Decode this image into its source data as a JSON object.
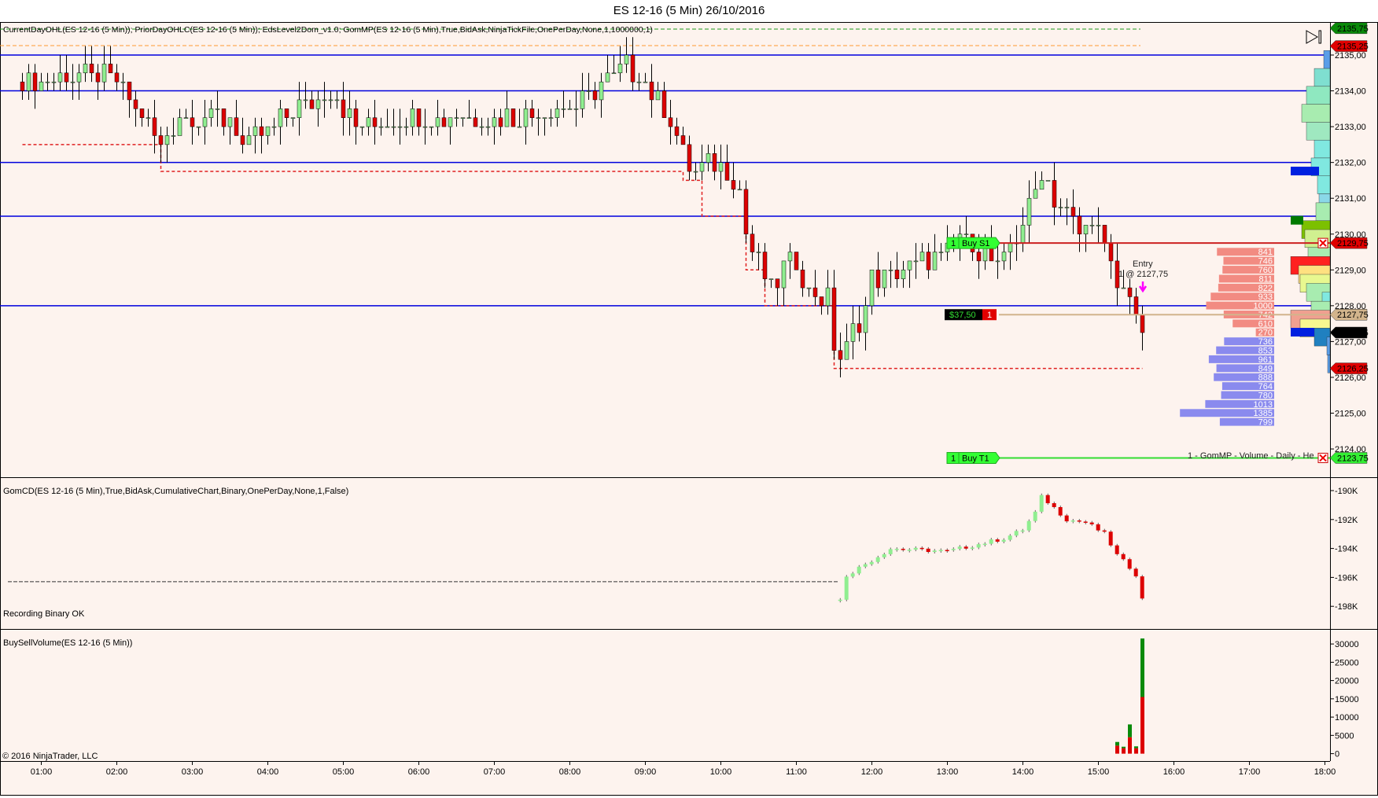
{
  "window": {
    "title": "ES 12-16 (5 Min)  26/10/2016"
  },
  "panels": {
    "price": {
      "indicator_label": "CurrentDayOHL(ES 12-16 (5 Min)); PriorDayOHLC(ES 12-16 (5 Min)); EdsLevel2Dom_v1.0; GomMP(ES 12-16 (5 Min),True,BidAsk,NinjaTickFile,OnePerDay,None,1,1000000,1)",
      "axis_ticks": [
        "2135,00",
        "2134,00",
        "2133,00",
        "2132,00",
        "2131,00",
        "2130,00",
        "2129,00",
        "2128,00",
        "2127,00",
        "2126,00",
        "2125,00",
        "2124,00"
      ],
      "axis_tick_values": [
        2135,
        2134,
        2133,
        2132,
        2131,
        2130,
        2129,
        2128,
        2127,
        2126,
        2125,
        2124
      ],
      "price_markers": [
        {
          "text": "2135,75",
          "value": 2135.75,
          "color": "#0a8a0a"
        },
        {
          "text": "2135,25",
          "value": 2135.25,
          "color": "#e00000"
        },
        {
          "text": "2129,75",
          "value": 2129.75,
          "color": "#e00000"
        },
        {
          "text": "2127,75",
          "value": 2127.75,
          "color": "#d2b48c"
        },
        {
          "text": "2127,25",
          "value": 2127.25,
          "color": "#000000"
        },
        {
          "text": "2126,25",
          "value": 2126.25,
          "color": "#e00000"
        },
        {
          "text": "2123,75",
          "value": 2123.75,
          "color": "#33ee33"
        }
      ],
      "blue_levels": [
        2135,
        2134,
        2132,
        2130.5,
        2128
      ],
      "price_path": [
        [
          "00:45",
          2134.25
        ],
        [
          "01:30",
          2134.5
        ],
        [
          "02:00",
          2134.25
        ],
        [
          "02:20",
          2133.25
        ],
        [
          "02:35",
          2132.5
        ],
        [
          "02:50",
          2133.25
        ],
        [
          "03:30",
          2133.25
        ],
        [
          "03:40",
          2132.5
        ],
        [
          "04:00",
          2132.75
        ],
        [
          "04:20",
          2133.5
        ],
        [
          "04:50",
          2134.0
        ],
        [
          "05:10",
          2133.0
        ],
        [
          "06:00",
          2133.25
        ],
        [
          "07:00",
          2133.25
        ],
        [
          "08:00",
          2133.5
        ],
        [
          "08:30",
          2134.25
        ],
        [
          "08:45",
          2134.75
        ],
        [
          "09:00",
          2134.25
        ],
        [
          "09:15",
          2133.5
        ],
        [
          "09:25",
          2132.75
        ],
        [
          "09:35",
          2131.75
        ],
        [
          "10:00",
          2132.0
        ],
        [
          "10:15",
          2131.25
        ],
        [
          "10:20",
          2130.0
        ],
        [
          "10:30",
          2129.25
        ],
        [
          "10:40",
          2128.5
        ],
        [
          "10:50",
          2129.0
        ],
        [
          "11:00",
          2129.25
        ],
        [
          "11:10",
          2128.25
        ],
        [
          "11:25",
          2128.25
        ],
        [
          "11:30",
          2127.0
        ],
        [
          "11:35",
          2126.5
        ],
        [
          "11:45",
          2127.25
        ],
        [
          "11:55",
          2128.0
        ],
        [
          "12:00",
          2128.75
        ],
        [
          "12:30",
          2129.0
        ],
        [
          "13:00",
          2129.5
        ],
        [
          "13:10",
          2130.0
        ],
        [
          "13:30",
          2129.5
        ],
        [
          "13:40",
          2129.0
        ],
        [
          "14:00",
          2130.25
        ],
        [
          "14:10",
          2131.25
        ],
        [
          "14:15",
          2131.75
        ],
        [
          "14:25",
          2131.0
        ],
        [
          "14:45",
          2130.0
        ],
        [
          "14:55",
          2130.5
        ],
        [
          "15:05",
          2129.5
        ],
        [
          "15:15",
          2128.5
        ],
        [
          "15:25",
          2128.5
        ],
        [
          "15:30",
          2127.75
        ],
        [
          "15:35",
          2127.0
        ]
      ],
      "prior_day_steps": [
        [
          "00:45",
          2132.5
        ],
        [
          "02:35",
          2131.75
        ],
        [
          "09:30",
          2131.5
        ],
        [
          "09:45",
          2130.5
        ],
        [
          "10:20",
          2129.0
        ],
        [
          "10:35",
          2128.0
        ],
        [
          "11:30",
          2126.25
        ],
        [
          "15:35",
          2126.25
        ]
      ],
      "dom_sell": {
        "prices": [
          2129.5,
          2129.25,
          2129.0,
          2128.75,
          2128.5,
          2128.25,
          2128.0,
          2127.75,
          2127.5,
          2127.25
        ],
        "sizes": [
          "841",
          "746",
          "760",
          "811",
          "822",
          "933",
          "1000",
          "742",
          "610",
          "270"
        ]
      },
      "dom_buy": {
        "prices": [
          2127.0,
          2126.75,
          2126.5,
          2126.25,
          2126.0,
          2125.75,
          2125.5,
          2125.25,
          2125.0,
          2124.75
        ],
        "sizes": [
          "736",
          "853",
          "961",
          "849",
          "888",
          "764",
          "780",
          "1013",
          "1385",
          "799"
        ]
      },
      "orders": {
        "stop": {
          "qty": "1",
          "label": "Buy S1",
          "price": 2129.75
        },
        "target": {
          "qty": "1",
          "label": "Buy T1",
          "price": 2123.75
        },
        "position": {
          "pnl": "$37,50",
          "qty": "1",
          "price": 2127.75
        },
        "entry": {
          "line1": "Entry",
          "line2": "1 @ 2127,75"
        }
      },
      "profile_label": "1 - GomMP - Volume - Daily - He",
      "current_day_high": 2135.75,
      "current_day_open": 2135.25
    },
    "cd": {
      "indicator_label": "GomCD(ES 12-16 (5 Min),True,BidAsk,CumulativeChart,Binary,OnePerDay,None,1,False)",
      "status": "Recording Binary OK",
      "axis_ticks": [
        "-190K",
        "-192K",
        "-194K",
        "-196K",
        "-198K"
      ],
      "axis_tick_values": [
        -190,
        -192,
        -194,
        -196,
        -198
      ],
      "flat_value": -196.3,
      "path": [
        [
          "11:35",
          -196.1
        ],
        [
          "12:00",
          -194.8
        ],
        [
          "12:15",
          -194.0
        ],
        [
          "13:00",
          -194.2
        ],
        [
          "13:15",
          -193.9
        ],
        [
          "13:45",
          -193.3
        ],
        [
          "14:00",
          -192.7
        ],
        [
          "14:10",
          -191.5
        ],
        [
          "14:15",
          -190.4
        ],
        [
          "14:25",
          -191.2
        ],
        [
          "14:35",
          -192.0
        ],
        [
          "14:50",
          -192.2
        ],
        [
          "15:05",
          -193.0
        ],
        [
          "15:15",
          -194.5
        ],
        [
          "15:25",
          -195.3
        ],
        [
          "15:30",
          -195.8
        ],
        [
          "15:35",
          -197.6
        ]
      ]
    },
    "volume": {
      "indicator_label": "BuySellVolume(ES 12-16 (5 Min))",
      "axis_ticks": [
        "30000",
        "25000",
        "20000",
        "15000",
        "10000",
        "5000",
        "0"
      ],
      "axis_tick_values": [
        30000,
        25000,
        20000,
        15000,
        10000,
        5000,
        0
      ],
      "bars": [
        [
          "15:15",
          1000,
          2200
        ],
        [
          "15:20",
          400,
          1500
        ],
        [
          "15:25",
          3500,
          4500
        ],
        [
          "15:30",
          500,
          1500
        ],
        [
          "15:35",
          16000,
          15500
        ]
      ]
    }
  },
  "time_axis": [
    "01:00",
    "02:00",
    "03:00",
    "04:00",
    "05:00",
    "06:00",
    "07:00",
    "08:00",
    "09:00",
    "10:00",
    "11:00",
    "12:00",
    "13:00",
    "14:00",
    "15:00",
    "16:00",
    "17:00",
    "18:00"
  ],
  "copyright": "© 2016 NinjaTrader, LLC",
  "colors": {
    "background": "#fdf3ee",
    "up": "#90ee90",
    "down": "#dd0000",
    "level": "#0000dd"
  }
}
